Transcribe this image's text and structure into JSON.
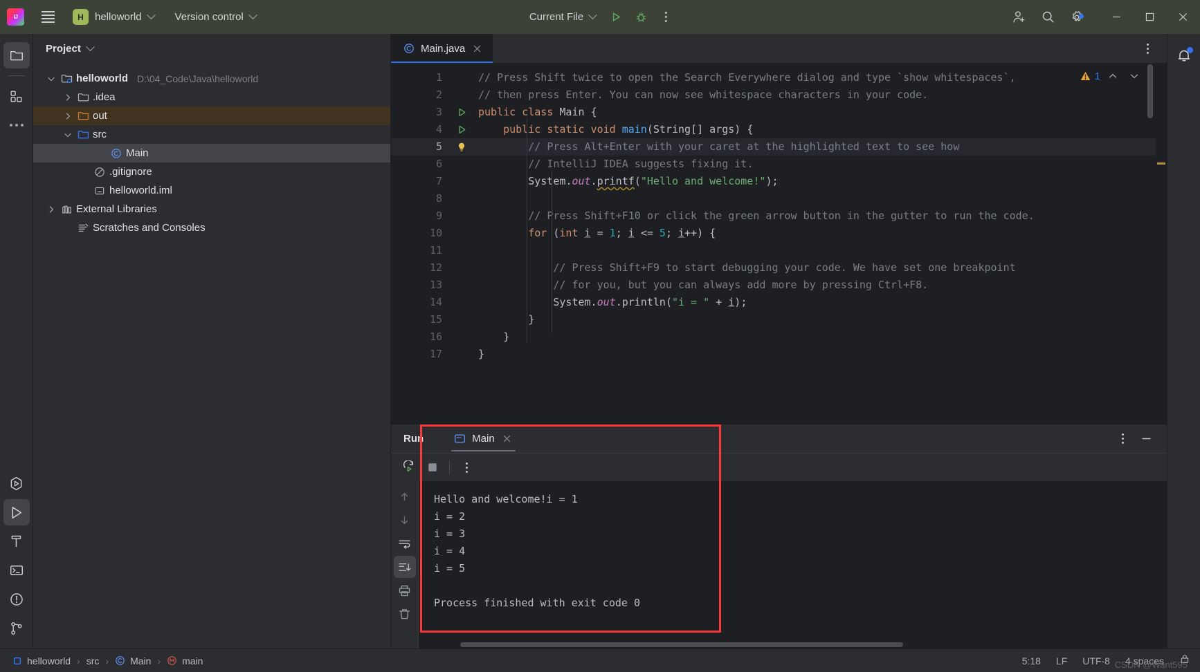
{
  "titlebar": {
    "logo_text": "IJ",
    "menu_icon": "hamburger-menu-icon",
    "project_badge": "H",
    "project_name": "helloworld",
    "vcs_label": "Version control",
    "run_config": "Current File",
    "run_icon": "run-icon",
    "debug_icon": "debug-icon",
    "more_icon": "more-vertical-icon",
    "account_icon": "account-add-icon",
    "search_icon": "search-icon",
    "settings_icon": "settings-gear-icon",
    "minimize_icon": "minimize-icon",
    "maximize_icon": "maximize-icon",
    "close_icon": "close-icon"
  },
  "stripe": {
    "project_icon": "folder-icon",
    "structure_icon": "structure-icon",
    "more_icon": "more-horizontal-icon",
    "services_icon": "services-icon",
    "run_icon": "run-panel-icon",
    "build_icon": "build-hammer-icon",
    "terminal_icon": "terminal-icon",
    "problems_icon": "problems-icon",
    "vcs_icon": "version-control-branch-icon"
  },
  "project": {
    "title": "Project",
    "tree": [
      {
        "label": "helloworld",
        "path": "D:\\04_Code\\Java\\helloworld",
        "icon": "module-folder-icon",
        "arrow": "down",
        "indent": 1,
        "bold": true,
        "state": "normal"
      },
      {
        "label": ".idea",
        "path": "",
        "icon": "folder-icon",
        "arrow": "right",
        "indent": 2,
        "bold": false,
        "state": "normal"
      },
      {
        "label": "out",
        "path": "",
        "icon": "folder-excluded-icon",
        "arrow": "right",
        "indent": 2,
        "bold": false,
        "state": "marked"
      },
      {
        "label": "src",
        "path": "",
        "icon": "folder-source-icon",
        "arrow": "down",
        "indent": 2,
        "bold": false,
        "state": "normal"
      },
      {
        "label": "Main",
        "path": "",
        "icon": "java-class-icon",
        "arrow": "none",
        "indent": 4,
        "bold": false,
        "state": "selected"
      },
      {
        "label": ".gitignore",
        "path": "",
        "icon": "gitignore-icon",
        "arrow": "none",
        "indent": 3,
        "bold": false,
        "state": "normal"
      },
      {
        "label": "helloworld.iml",
        "path": "",
        "icon": "iml-file-icon",
        "arrow": "none",
        "indent": 3,
        "bold": false,
        "state": "normal"
      },
      {
        "label": "External Libraries",
        "path": "",
        "icon": "library-icon",
        "arrow": "right",
        "indent": 1,
        "bold": false,
        "state": "normal"
      },
      {
        "label": "Scratches and Consoles",
        "path": "",
        "icon": "scratches-icon",
        "arrow": "none",
        "indent": 2,
        "bold": false,
        "state": "normal"
      }
    ]
  },
  "editor": {
    "tab_label": "Main.java",
    "tab_icon": "java-class-icon",
    "tab_close_icon": "close-icon",
    "options_icon": "more-vertical-icon",
    "warning_icon": "warning-triangle-icon",
    "warning_count": "1",
    "prev_problem_icon": "chevron-up-icon",
    "next_problem_icon": "chevron-down-icon",
    "current_line": 5,
    "lines": [
      {
        "n": "1",
        "gutter": "none"
      },
      {
        "n": "2",
        "gutter": "none"
      },
      {
        "n": "3",
        "gutter": "run"
      },
      {
        "n": "4",
        "gutter": "run"
      },
      {
        "n": "5",
        "gutter": "bulb"
      },
      {
        "n": "6",
        "gutter": "none"
      },
      {
        "n": "7",
        "gutter": "none"
      },
      {
        "n": "8",
        "gutter": "none"
      },
      {
        "n": "9",
        "gutter": "none"
      },
      {
        "n": "10",
        "gutter": "none"
      },
      {
        "n": "11",
        "gutter": "none"
      },
      {
        "n": "12",
        "gutter": "none"
      },
      {
        "n": "13",
        "gutter": "none"
      },
      {
        "n": "14",
        "gutter": "none"
      },
      {
        "n": "15",
        "gutter": "none"
      },
      {
        "n": "16",
        "gutter": "none"
      },
      {
        "n": "17",
        "gutter": "none"
      }
    ],
    "code_text": [
      "// Press Shift twice to open the Search Everywhere dialog and type `show whitespaces`,",
      "// then press Enter. You can now see whitespace characters in your code.",
      "public class Main {",
      "    public static void main(String[] args) {",
      "        // Press Alt+Enter with your caret at the highlighted text to see how",
      "        // IntelliJ IDEA suggests fixing it.",
      "        System.out.printf(\"Hello and welcome!\");",
      "",
      "        // Press Shift+F10 or click the green arrow button in the gutter to run the code.",
      "        for (int i = 1; i <= 5; i++) {",
      "",
      "            // Press Shift+F9 to start debugging your code. We have set one breakpoint",
      "            // for you, but you can always add more by pressing Ctrl+F8.",
      "            System.out.println(\"i = \" + i);",
      "        }",
      "    }",
      "}"
    ]
  },
  "run_panel": {
    "title": "Run",
    "tab_label": "Main",
    "tab_icon": "console-icon",
    "tab_close_icon": "close-icon",
    "options_icon": "more-vertical-icon",
    "minimize_icon": "minimize-panel-icon",
    "rerun_icon": "rerun-icon",
    "stop_icon": "stop-icon",
    "more_icon": "more-vertical-icon",
    "side_buttons": [
      {
        "icon": "arrow-up-icon",
        "name": "up-the-stack-trace",
        "active": false
      },
      {
        "icon": "arrow-down-icon",
        "name": "down-the-stack-trace",
        "active": false
      },
      {
        "icon": "soft-wrap-icon",
        "name": "soft-wrap-toggle",
        "active": false
      },
      {
        "icon": "scroll-to-end-icon",
        "name": "scroll-to-end-toggle",
        "active": true
      },
      {
        "icon": "print-icon",
        "name": "print-button",
        "active": false
      },
      {
        "icon": "trash-icon",
        "name": "clear-all-button",
        "active": false
      }
    ],
    "console_lines": [
      "Hello and welcome!i = 1",
      "i = 2",
      "i = 3",
      "i = 4",
      "i = 5",
      "",
      "Process finished with exit code 0"
    ]
  },
  "statusbar": {
    "breadcrumb": [
      {
        "label": "helloworld",
        "icon": "module-icon"
      },
      {
        "label": "src",
        "icon": "none"
      },
      {
        "label": "Main",
        "icon": "java-class-icon"
      },
      {
        "label": "main",
        "icon": "method-icon"
      }
    ],
    "separator": "›",
    "caret_position": "5:18",
    "line_separator": "LF",
    "encoding": "UTF-8",
    "indent": "4 spaces",
    "lock_icon": "lock-icon",
    "watermark": "CSDN @Want595"
  },
  "notification": {
    "bell_icon": "notification-bell-icon"
  },
  "colors": {
    "accent_blue": "#3574f0",
    "titlebar_green": "#3d4237",
    "annotation_red": "#fa3a3a",
    "editor_bg": "#1e1f22",
    "panel_bg": "#2b2d30",
    "warning_yellow": "#e8a33d"
  }
}
